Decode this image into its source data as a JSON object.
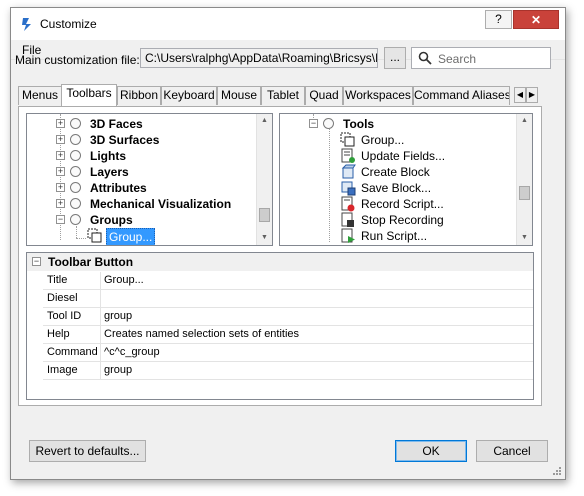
{
  "window": {
    "title": "Customize",
    "help_label": "?",
    "close_label": "✕"
  },
  "menu": {
    "file": "File"
  },
  "customization_file": {
    "label": "Main customization file:",
    "path": "C:\\Users\\ralphg\\AppData\\Roaming\\Bricsys\\Bricsc",
    "browse_label": "...",
    "search_placeholder": "Search"
  },
  "tabs": [
    "Menus",
    "Toolbars",
    "Ribbon",
    "Keyboard",
    "Mouse",
    "Tablet",
    "Quad",
    "Workspaces",
    "Command Aliases"
  ],
  "active_tab": "Toolbars",
  "left_tree": {
    "items": [
      "3D Faces",
      "3D Surfaces",
      "Lights",
      "Layers",
      "Attributes",
      "Mechanical Visualization",
      "Groups"
    ],
    "child": "Group..."
  },
  "right_tree": {
    "root": "Tools",
    "items": [
      "Group...",
      "Update Fields...",
      "Create Block",
      "Save Block...",
      "Record Script...",
      "Stop Recording",
      "Run Script..."
    ]
  },
  "properties": {
    "title": "Toolbar Button",
    "rows": [
      {
        "name": "Title",
        "value": "Group..."
      },
      {
        "name": "Diesel",
        "value": ""
      },
      {
        "name": "Tool ID",
        "value": "group"
      },
      {
        "name": "Help",
        "value": "Creates named selection sets of entities"
      },
      {
        "name": "Command",
        "value": "^c^c_group"
      },
      {
        "name": "Image",
        "value": "group"
      }
    ]
  },
  "buttons": {
    "revert": "Revert to defaults...",
    "ok": "OK",
    "cancel": "Cancel"
  },
  "colors": {
    "selection": "#3399ff",
    "close": "#c9423a",
    "default_border": "#0078d7"
  }
}
